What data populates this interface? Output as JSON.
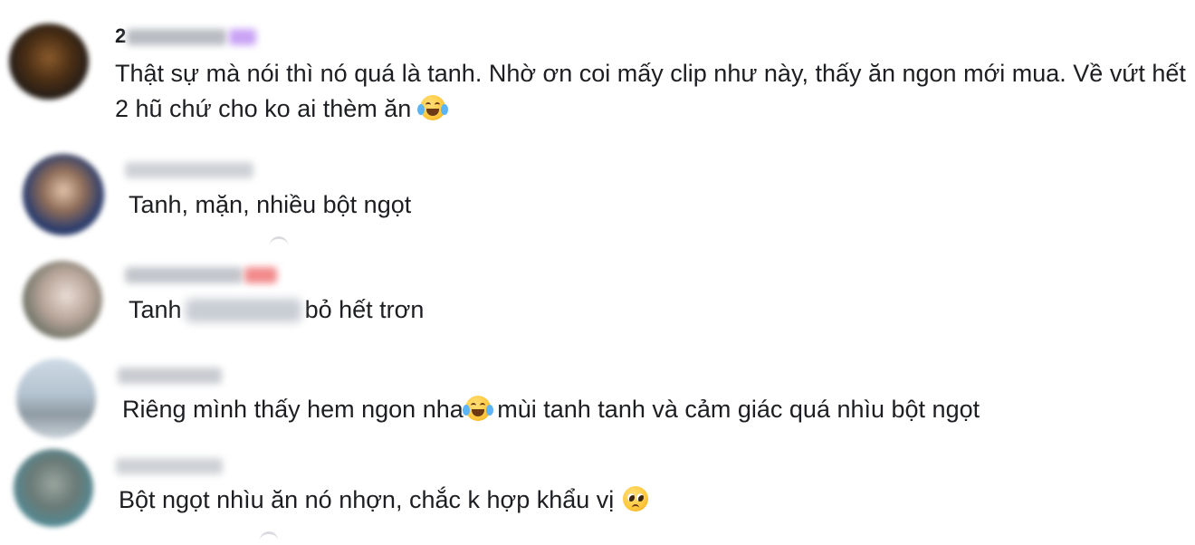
{
  "comments": [
    {
      "author_visible": "2",
      "text": "Thật sự mà nói thì nó quá là tanh. Nhờ ơn coi mấy clip như này, thấy ăn ngon mới mua. Về vứt hết 2 hũ chứ cho ko ai thèm ăn",
      "emoji": "face-with-tears-of-joy-icon"
    },
    {
      "text": "Tanh, mặn, nhiều bột ngọt"
    },
    {
      "text_before": "Tanh",
      "text_after": "bỏ hết trơn"
    },
    {
      "text_before": "Riêng mình thấy hem ngon nha",
      "emoji": "face-with-tears-of-joy-icon",
      "text_after": " mùi tanh tanh và cảm giác quá nhìu bột ngọt"
    },
    {
      "text": "Bột ngọt nhìu ăn nó nhợn, chắc k hợp khẩu vị ",
      "emoji": "pleading-face-icon"
    }
  ],
  "colors": {
    "text": "#1c1e21",
    "blur_gray": "#c9cdd4",
    "badge_purple": "#c9a3f5",
    "badge_red": "#f28b8b"
  }
}
